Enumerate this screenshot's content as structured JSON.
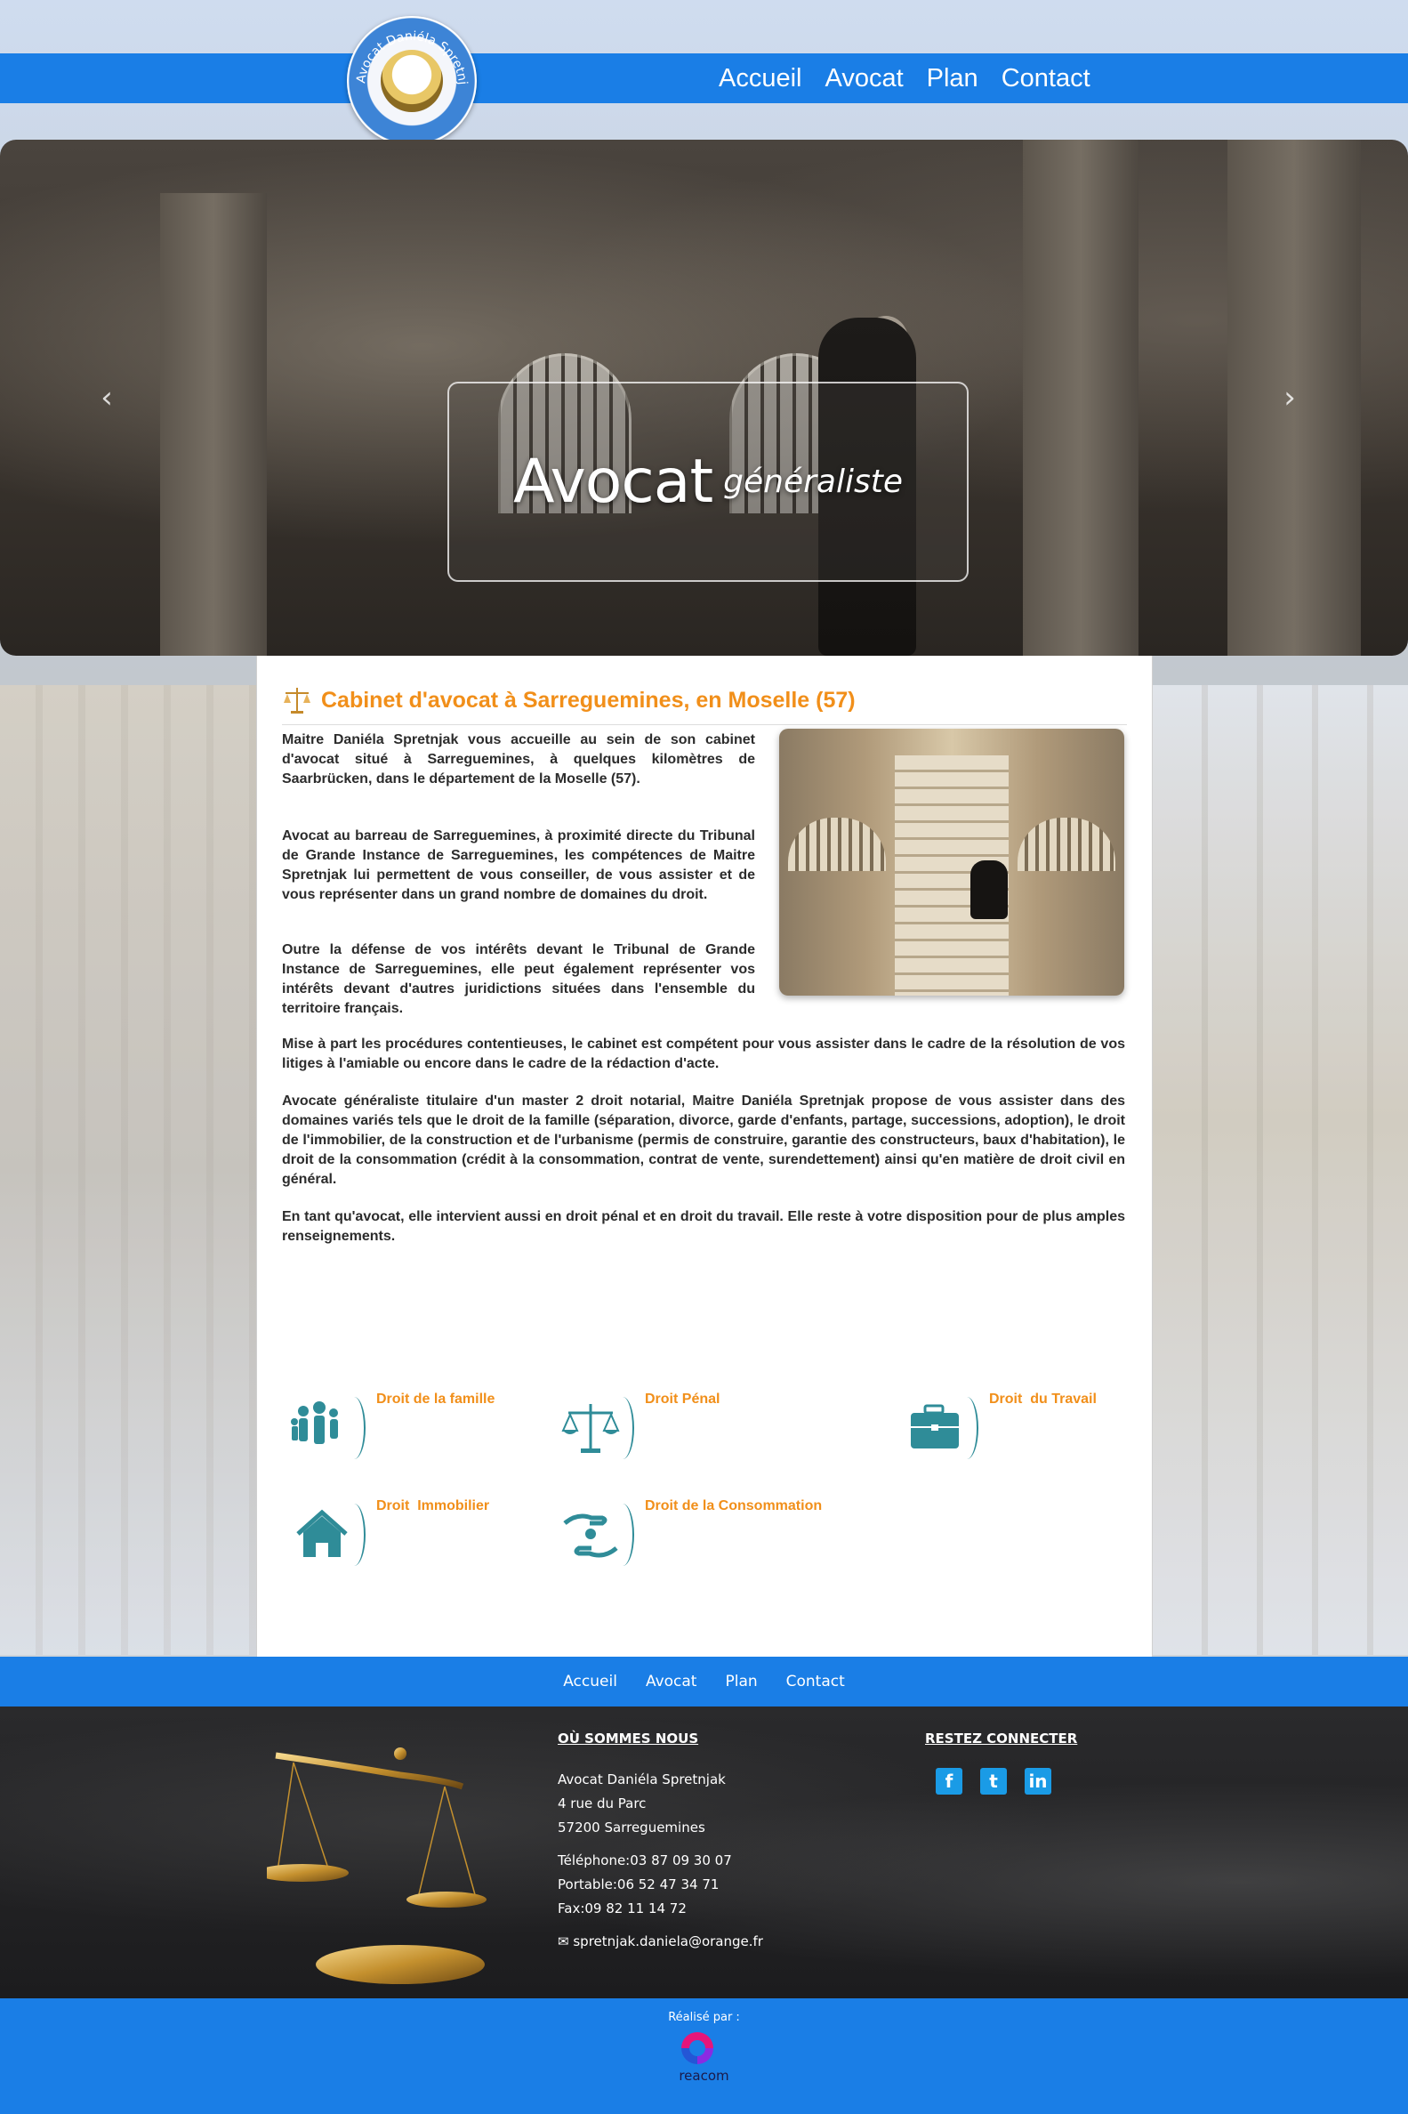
{
  "header": {
    "logo_text": "Avocat Daniéla Spretnjak",
    "nav": [
      "Accueil",
      "Avocat",
      "Plan",
      "Contact"
    ]
  },
  "hero": {
    "title": "Avocat",
    "subtitle": "généraliste",
    "prev_arrow": "‹",
    "next_arrow": "›"
  },
  "main": {
    "title": "Cabinet d'avocat à Sarreguemines, en Moselle (57)",
    "paragraphs": [
      "Maitre Daniéla Spretnjak vous accueille au sein de son cabinet d'avocat situé à Sarreguemines, à quelques kilomètres de Saarbrücken, dans le département de la Moselle (57).",
      "Avocat au barreau de Sarreguemines, à proximité directe du Tribunal de Grande Instance de Sarreguemines, les compétences de Maitre Spretnjak lui permettent de vous conseiller, de vous assister et de vous représenter dans un grand nombre de domaines du droit.",
      "Outre la défense de vos intérêts devant le Tribunal de Grande Instance de Sarreguemines, elle peut également représenter vos intérêts devant d'autres juridictions situées dans l'ensemble du territoire français.",
      "Mise à part les procédures contentieuses, le cabinet est compétent pour vous assister dans le cadre de la résolution de vos litiges à l'amiable ou encore dans le cadre de la rédaction d'acte.",
      "Avocate généraliste titulaire d'un master 2 droit notarial, Maitre Daniéla Spretnjak propose de vous assister dans des domaines variés tels que le droit de la famille (séparation, divorce, garde d'enfants, partage, successions, adoption), le droit de l'immobilier, de la construction et de l'urbanisme (permis de construire, garantie des constructeurs, baux d'habitation), le droit de la consommation (crédit à la consommation, contrat de vente, surendettement) ainsi qu'en matière de droit civil en général.",
      "En tant qu'avocat, elle intervient aussi en droit pénal et en droit du travail. Elle reste à votre disposition pour de plus amples renseignements."
    ]
  },
  "services": [
    {
      "label": "Droit de la famille",
      "icon": "family-icon"
    },
    {
      "label": "Droit Pénal",
      "icon": "scales-icon"
    },
    {
      "label": "Droit  du Travail",
      "icon": "briefcase-icon"
    },
    {
      "label": "Droit  Immobilier",
      "icon": "house-icon"
    },
    {
      "label": "Droit de la Consommation",
      "icon": "hand-money-icon"
    }
  ],
  "footer_nav": [
    "Accueil",
    "Avocat",
    "Plan",
    "Contact"
  ],
  "footer": {
    "where_heading": "OÙ SOMMES NOUS",
    "name": "Avocat Daniéla Spretnjak",
    "street": "4 rue du Parc",
    "city": "57200 Sarreguemines",
    "telephone": "Téléphone:03 87 09 30 07",
    "portable": "Portable:06 52 47 34 71",
    "fax": "Fax:09 82 11 14 72",
    "email": "spretnjak.daniela@orange.fr",
    "social_heading": "RESTEZ CONNECTER",
    "social": [
      "f",
      "t",
      "in"
    ]
  },
  "credits": {
    "label": "Réalisé par :",
    "brand": "reacom"
  },
  "colors": {
    "blue_bar": "#1a7ee6",
    "accent_orange": "#f18f1a",
    "icon_teal": "#2f8c98"
  }
}
